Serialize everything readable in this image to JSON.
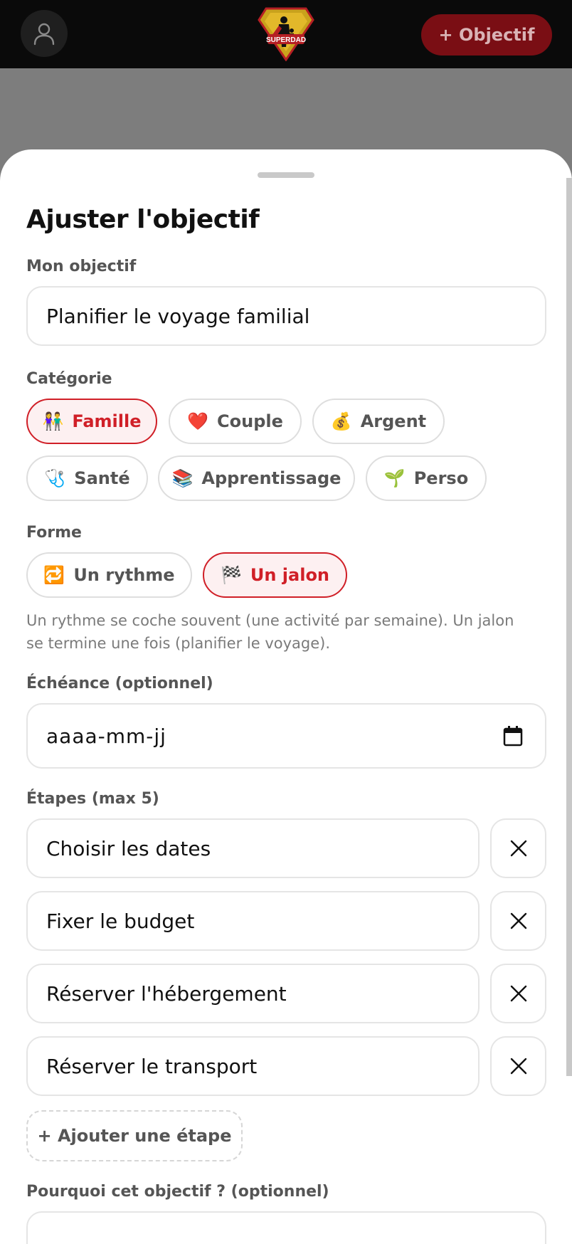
{
  "header": {
    "logo_text": "SUPERDAD",
    "add_goal_label": "+ Objectif"
  },
  "sheet": {
    "title": "Ajuster l'objectif",
    "goal": {
      "label": "Mon objectif",
      "value": "Planifier le voyage familial"
    },
    "category": {
      "label": "Catégorie",
      "options": [
        {
          "emoji": "👫",
          "label": "Famille",
          "selected": true
        },
        {
          "emoji": "❤️",
          "label": "Couple",
          "selected": false
        },
        {
          "emoji": "💰",
          "label": "Argent",
          "selected": false
        },
        {
          "emoji": "🩺",
          "label": "Santé",
          "selected": false
        },
        {
          "emoji": "📚",
          "label": "Apprentissage",
          "selected": false
        },
        {
          "emoji": "🌱",
          "label": "Perso",
          "selected": false
        }
      ]
    },
    "form": {
      "label": "Forme",
      "options": [
        {
          "emoji": "🔁",
          "label": "Un rythme",
          "selected": false
        },
        {
          "emoji": "🏁",
          "label": "Un jalon",
          "selected": true
        }
      ],
      "hint": "Un rythme se coche souvent (une activité par semaine). Un jalon se termine une fois (planifier le voyage)."
    },
    "deadline": {
      "label": "Échéance (optionnel)",
      "placeholder": "aaaa-mm-jj"
    },
    "steps": {
      "label": "Étapes (max 5)",
      "items": [
        "Choisir les dates",
        "Fixer le budget",
        "Réserver l'hébergement",
        "Réserver le transport"
      ],
      "add_label": "+ Ajouter une étape"
    },
    "why": {
      "label": "Pourquoi cet objectif ? (optionnel)"
    }
  },
  "colors": {
    "accent": "#d01f27",
    "accent_bg": "#fdf0f1",
    "header_bg": "#0a0a0a",
    "add_goal_bg": "#7a0e14"
  }
}
